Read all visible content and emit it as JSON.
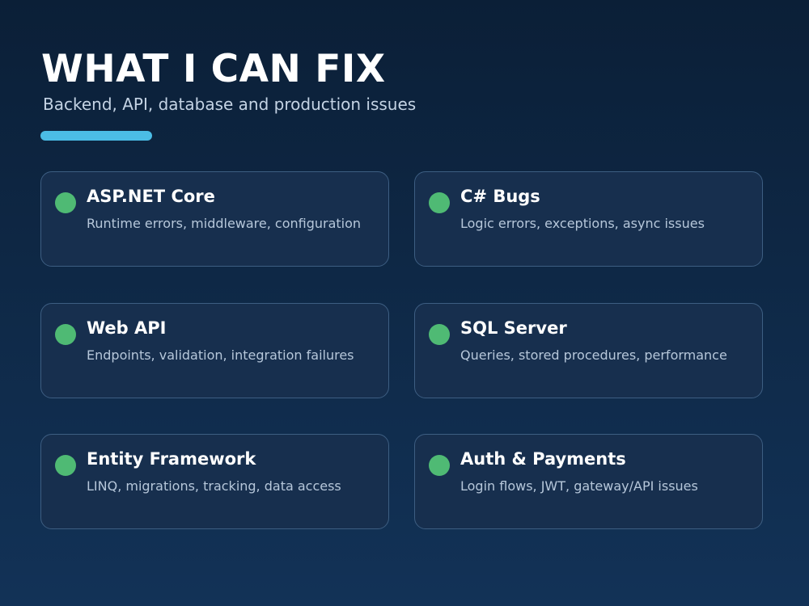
{
  "header": {
    "title": "WHAT I CAN FIX",
    "subtitle": "Backend, API, database and production issues"
  },
  "colors": {
    "background_top": "#0b1f37",
    "background_bottom": "#123257",
    "accent": "#4bbde6",
    "bullet": "#4fba74",
    "card_fill": "#172f4e",
    "card_border": "#3d5e82"
  },
  "cards": [
    {
      "title": "ASP.NET Core",
      "description": "Runtime errors, middleware, configuration"
    },
    {
      "title": "C# Bugs",
      "description": "Logic errors, exceptions, async issues"
    },
    {
      "title": "Web API",
      "description": "Endpoints, validation, integration failures"
    },
    {
      "title": "SQL Server",
      "description": "Queries, stored procedures, performance"
    },
    {
      "title": "Entity Framework",
      "description": "LINQ, migrations, tracking, data access"
    },
    {
      "title": "Auth & Payments",
      "description": "Login flows, JWT, gateway/API issues"
    }
  ]
}
